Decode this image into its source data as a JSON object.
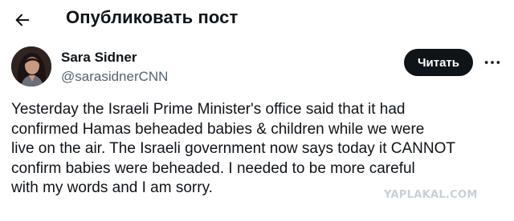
{
  "header": {
    "back_icon": "arrow-left-icon",
    "title": "Опубликовать пост"
  },
  "author": {
    "name": "Sara Sidner",
    "handle": "@sarasidnerCNN",
    "avatar_icon": "avatar-photo"
  },
  "actions": {
    "follow_label": "Читать",
    "more_icon": "more-horizontal-icon"
  },
  "post": {
    "lines": [
      "Yesterday the Israeli Prime Minister's office said that it had",
      "confirmed Hamas beheaded babies & children while we were",
      "live on the air. The Israeli government now says today it CANNOT",
      "confirm  babies were beheaded.  I needed to be more careful",
      "with my words and I am sorry."
    ]
  },
  "watermark": "YAPLAKAL.COM",
  "colors": {
    "text_primary": "#0f1419",
    "text_secondary": "#536471",
    "button_bg": "#0f1419",
    "button_text": "#ffffff",
    "watermark": "#c8d0d6"
  }
}
